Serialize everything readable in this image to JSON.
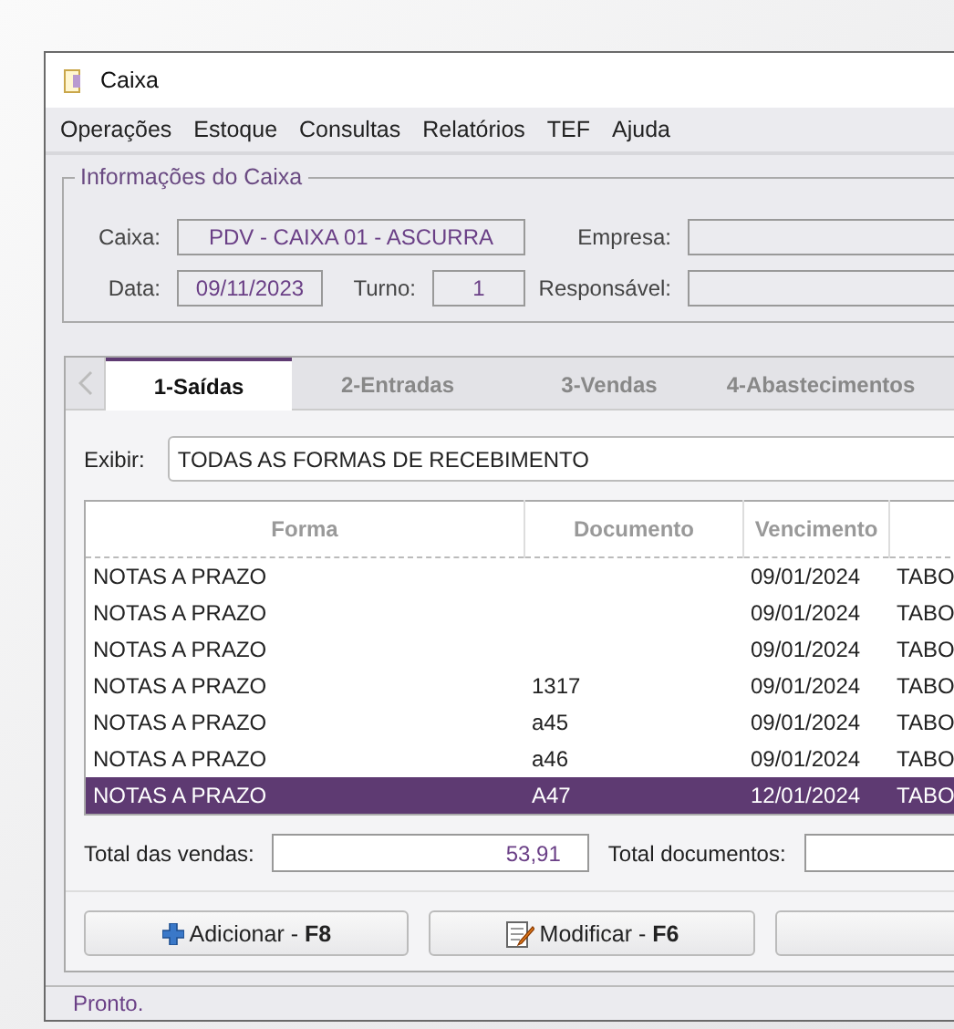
{
  "window": {
    "title": "Caixa"
  },
  "menu": [
    "Operações",
    "Estoque",
    "Consultas",
    "Relatórios",
    "TEF",
    "Ajuda"
  ],
  "info_group": {
    "title": "Informações do Caixa",
    "fields": [
      {
        "label": "Caixa:",
        "value": "PDV - CAIXA 01 - ASCURRA"
      },
      {
        "label": "Empresa:"
      },
      {
        "label": "Data:",
        "value": "09/11/2023"
      },
      {
        "label": "Turno:",
        "value": "1"
      },
      {
        "label": "Responsável:"
      }
    ]
  },
  "tabs": [
    {
      "label": "1-Saídas",
      "selected": true
    },
    {
      "label": "2-Entradas",
      "selected": false
    },
    {
      "label": "3-Vendas",
      "selected": false
    },
    {
      "label": "4-Abastecimentos",
      "selected": false
    }
  ],
  "filter": {
    "label": "Exibir:",
    "value": "TODAS AS FORMAS DE RECEBIMENTO"
  },
  "table": {
    "columns": [
      "Forma",
      "Documento",
      "Vencimento"
    ],
    "rows": [
      {
        "cells": [
          "NOTAS A PRAZO",
          null,
          "09/01/2024",
          "TABO"
        ],
        "selected": false
      },
      {
        "cells": [
          "NOTAS A PRAZO",
          null,
          "09/01/2024",
          "TABO"
        ],
        "selected": false
      },
      {
        "cells": [
          "NOTAS A PRAZO",
          null,
          "09/01/2024",
          "TABO"
        ],
        "selected": false
      },
      {
        "cells": [
          "NOTAS A PRAZO",
          "1317",
          "09/01/2024",
          "TABO"
        ],
        "selected": false
      },
      {
        "cells": [
          "NOTAS A PRAZO",
          "a45",
          "09/01/2024",
          "TABO"
        ],
        "selected": false
      },
      {
        "cells": [
          "NOTAS A PRAZO",
          "a46",
          "09/01/2024",
          "TABO"
        ],
        "selected": false
      },
      {
        "cells": [
          "NOTAS A PRAZO",
          "A47",
          "12/01/2024",
          "TABO"
        ],
        "selected": true
      }
    ]
  },
  "totals": [
    {
      "label": "Total das vendas:",
      "value": "53,91"
    },
    {
      "label": "Total documentos:"
    }
  ],
  "buttons": [
    {
      "kind": "add",
      "label": "Adicionar - **F8**"
    },
    {
      "kind": "edit",
      "label": "Modificar - **F6**"
    },
    {
      "kind": "blank"
    }
  ],
  "status_bar": "Pronto."
}
